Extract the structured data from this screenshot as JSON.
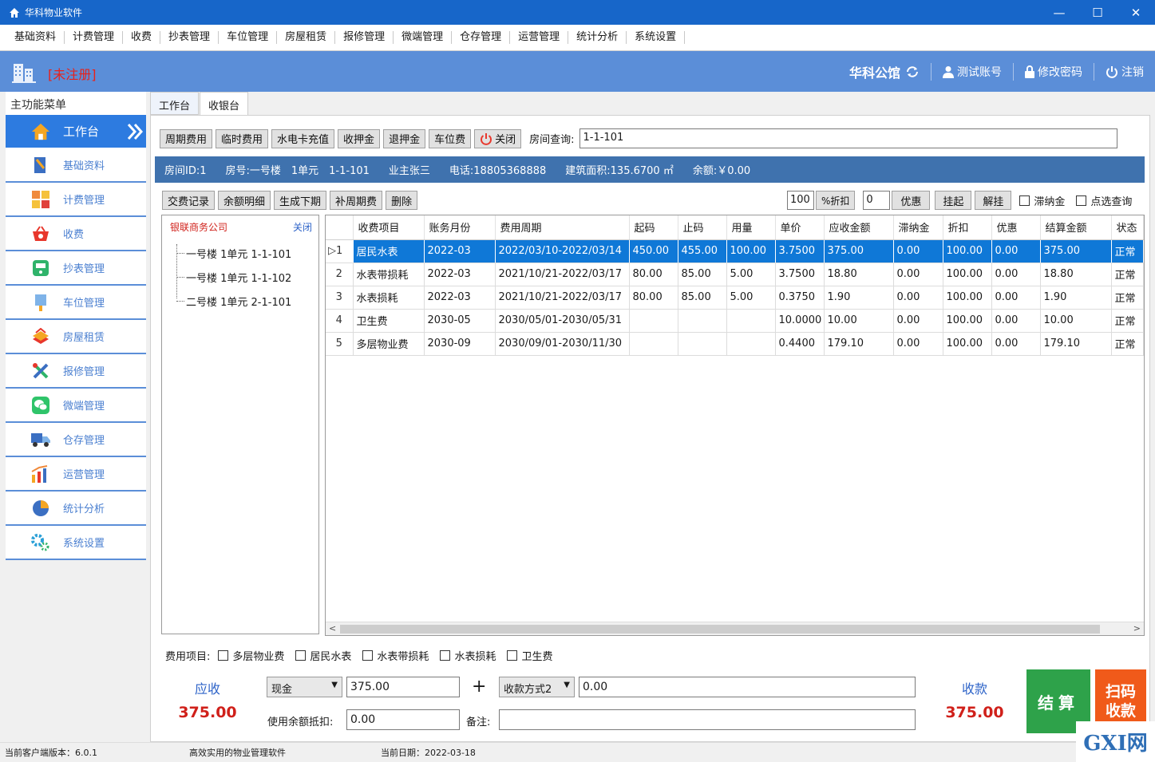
{
  "window": {
    "title": "华科物业软件",
    "minimize": "—",
    "maximize": "☐",
    "close": "✕"
  },
  "menu": [
    "基础资料",
    "计费管理",
    "收费",
    "抄表管理",
    "车位管理",
    "房屋租赁",
    "报修管理",
    "微端管理",
    "仓存管理",
    "运营管理",
    "统计分析",
    "系统设置"
  ],
  "header": {
    "register": "[未注册]",
    "company": "华科公馆",
    "account": "测试账号",
    "change_password": "修改密码",
    "logout": "注销"
  },
  "sidebar": {
    "title": "主功能菜单",
    "active": "工作台",
    "items": [
      "基础资料",
      "计费管理",
      "收费",
      "抄表管理",
      "车位管理",
      "房屋租赁",
      "报修管理",
      "微端管理",
      "仓存管理",
      "运营管理",
      "统计分析",
      "系统设置"
    ]
  },
  "tabs": [
    "工作台",
    "收银台"
  ],
  "toolbar": {
    "buttons": [
      "周期费用",
      "临时费用",
      "水电卡充值",
      "收押金",
      "退押金",
      "车位费"
    ],
    "close": "关闭",
    "room_query_label": "房间查询:",
    "room_query_value": "1-1-101"
  },
  "info": {
    "room_id": "房间ID:1",
    "room_no": "房号:一号楼　1单元　1-1-101",
    "owner": "业主张三",
    "phone": "电话:18805368888",
    "area": "建筑面积:135.6700 ㎡",
    "balance": "余额:￥0.00"
  },
  "toolbar2": {
    "buttons": [
      "交费记录",
      "余额明细",
      "生成下期",
      "补周期费",
      "删除"
    ],
    "discount_value": "100",
    "discount_btn": "%折扣",
    "offer_value": "0",
    "offer_btn": "优惠",
    "hold": "挂起",
    "unhold": "解挂",
    "late_fee": "滞纳金",
    "click_query": "点选查询"
  },
  "tree": {
    "company": "银联商务公司",
    "close": "关闭",
    "nodes": [
      "一号楼 1单元 1-1-101",
      "一号楼 1单元 1-1-102",
      "二号楼 1单元 2-1-101"
    ]
  },
  "table": {
    "headers": [
      "收费项目",
      "账务月份",
      "费用周期",
      "起码",
      "止码",
      "用量",
      "单价",
      "应收金额",
      "滞纳金",
      "折扣",
      "优惠",
      "结算金额",
      "状态"
    ],
    "rows": [
      {
        "n": "1",
        "c": [
          "居民水表",
          "2022-03",
          "2022/03/10-2022/03/14",
          "450.00",
          "455.00",
          "100.00",
          "3.7500",
          "375.00",
          "0.00",
          "100.00",
          "0.00",
          "375.00",
          "正常"
        ]
      },
      {
        "n": "2",
        "c": [
          "水表带损耗",
          "2022-03",
          "2021/10/21-2022/03/17",
          "80.00",
          "85.00",
          "5.00",
          "3.7500",
          "18.80",
          "0.00",
          "100.00",
          "0.00",
          "18.80",
          "正常"
        ]
      },
      {
        "n": "3",
        "c": [
          "水表损耗",
          "2022-03",
          "2021/10/21-2022/03/17",
          "80.00",
          "85.00",
          "5.00",
          "0.3750",
          "1.90",
          "0.00",
          "100.00",
          "0.00",
          "1.90",
          "正常"
        ]
      },
      {
        "n": "4",
        "c": [
          "卫生费",
          "2030-05",
          "2030/05/01-2030/05/31",
          "",
          "",
          "",
          "10.0000",
          "10.00",
          "0.00",
          "100.00",
          "0.00",
          "10.00",
          "正常"
        ]
      },
      {
        "n": "5",
        "c": [
          "多层物业费",
          "2030-09",
          "2030/09/01-2030/11/30",
          "",
          "",
          "",
          "0.4400",
          "179.10",
          "0.00",
          "100.00",
          "0.00",
          "179.10",
          "正常"
        ]
      }
    ]
  },
  "fee_items": {
    "label": "费用项目:",
    "items": [
      "多层物业费",
      "居民水表",
      "水表带损耗",
      "水表损耗",
      "卫生费"
    ]
  },
  "payment": {
    "receivable_label": "应收",
    "receivable_value": "375.00",
    "method1": "现金",
    "amount1": "375.00",
    "plus": "+",
    "method2": "收款方式2",
    "amount2": "0.00",
    "balance_deduct_label": "使用余额抵扣:",
    "balance_deduct_value": "0.00",
    "remark_label": "备注:",
    "remark_value": "",
    "received_label": "收款",
    "received_value": "375.00",
    "settle": "结算",
    "scan_line1": "扫码",
    "scan_line2": "收款"
  },
  "status": {
    "version": "当前客户端版本：6.0.1",
    "slogan": "高效实用的物业管理软件",
    "date": "当前日期：2022-03-18"
  },
  "watermark": "GXI网",
  "colors": {
    "titlebar": "#1766c9",
    "header": "#5b8ed8",
    "selected_row": "#0f78d7",
    "settle": "#2ea24a",
    "scan": "#f05a1a",
    "danger": "#d0201a"
  }
}
